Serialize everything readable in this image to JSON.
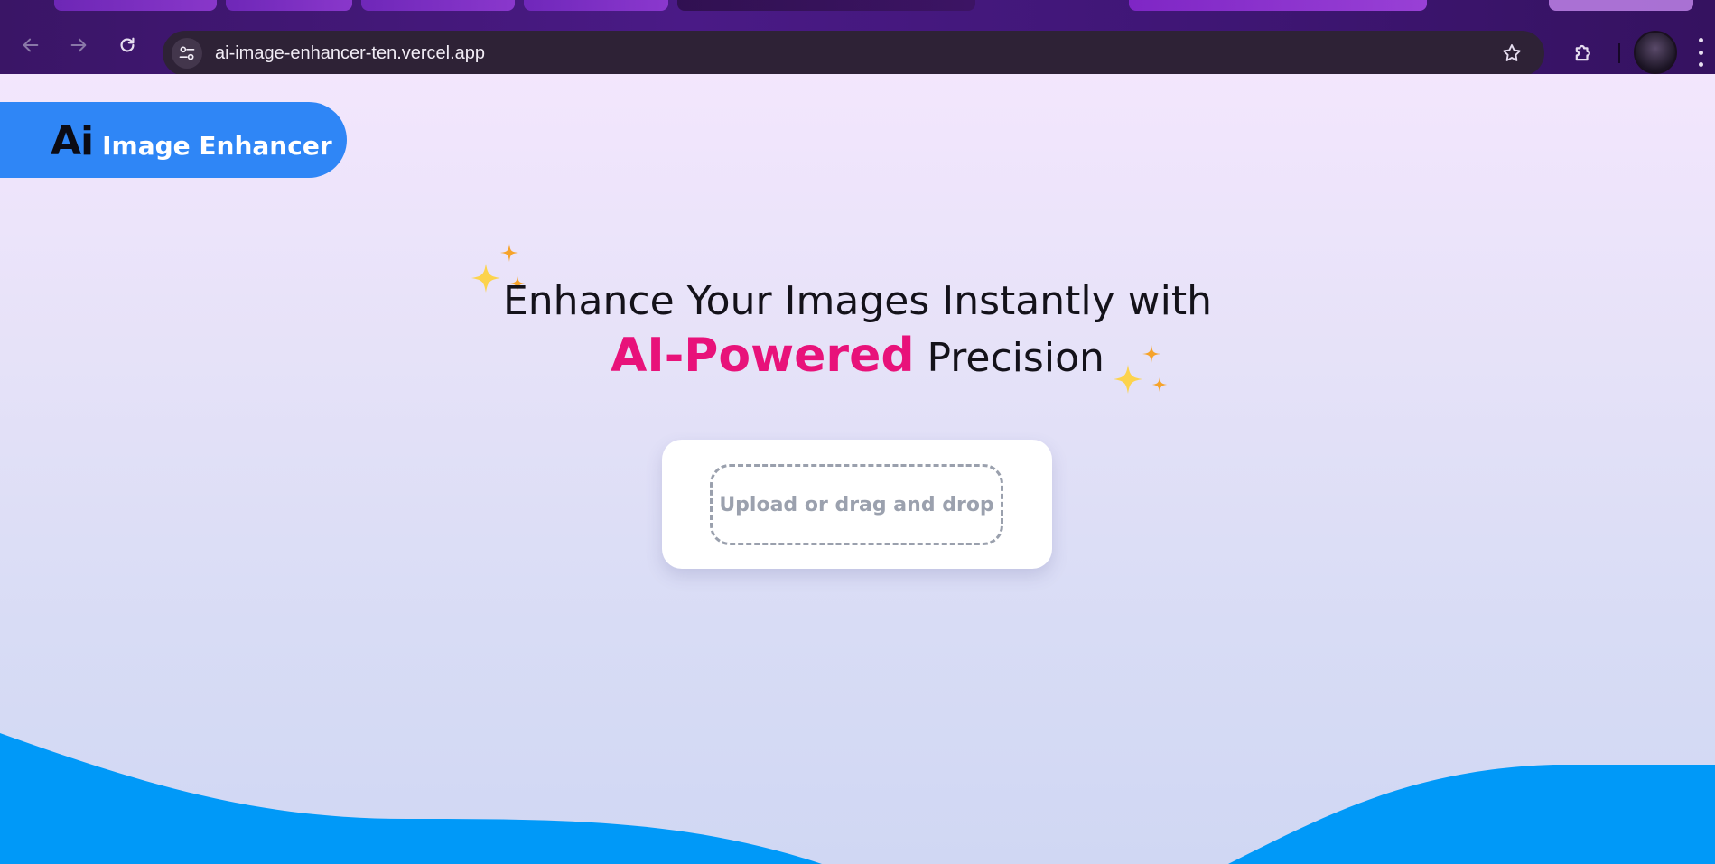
{
  "browser": {
    "url": "ai-image-enhancer-ten.vercel.app",
    "back_icon": "arrow-left-icon",
    "forward_icon": "arrow-right-icon",
    "reload_icon": "reload-icon",
    "bookmark_icon": "star-icon",
    "extensions_icon": "puzzle-icon",
    "menu_icon": "kebab-menu-icon"
  },
  "logo": {
    "mark": "Ai",
    "text": "Image Enhancer"
  },
  "hero": {
    "line1": "Enhance Your Images Instantly with",
    "accent": "AI-Powered",
    "line2_rest": " Precision"
  },
  "upload": {
    "label": "Upload or drag and drop"
  },
  "colors": {
    "logo_pill": "#2f86f6",
    "accent_pink": "#e8127a",
    "wave_blue": "#0099f8",
    "sparkle_yellow": "#fcd34d",
    "sparkle_orange": "#f6a32a"
  }
}
